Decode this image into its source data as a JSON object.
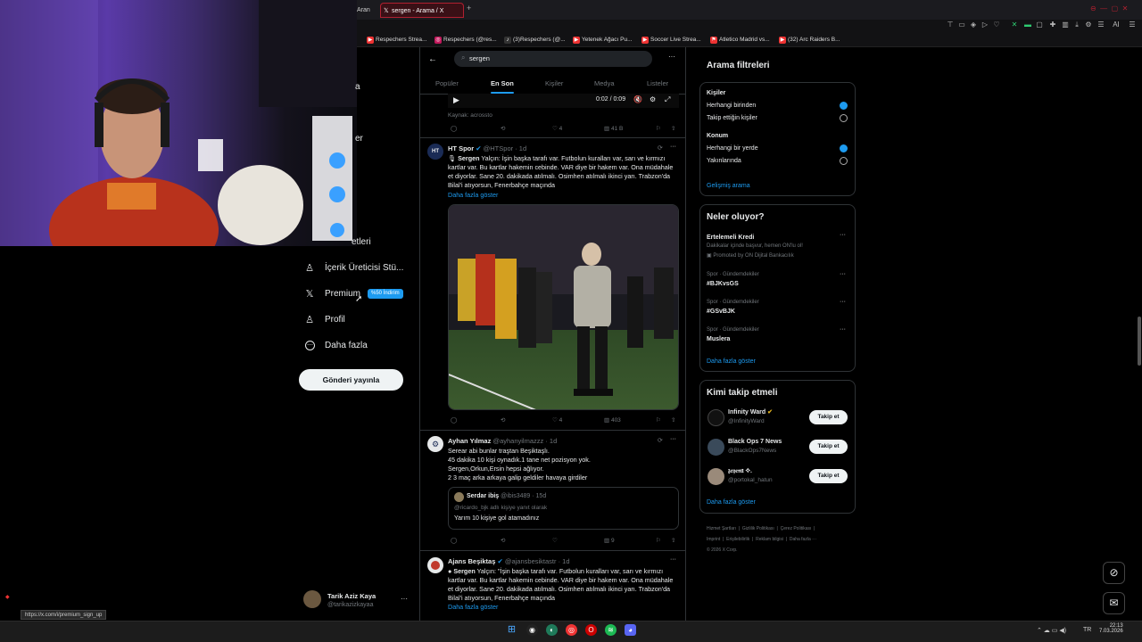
{
  "browser": {
    "tabs": [
      {
        "label": "Aran",
        "active": false
      },
      {
        "label": "sergen - Arama / X",
        "active": true
      }
    ],
    "new_tab": "+",
    "bookmarks": [
      {
        "label": "Respechers Strea...",
        "color": "#e33"
      },
      {
        "label": "Respechers (@res...",
        "color": "#c2185b"
      },
      {
        "label": "(3)Respechers (@...",
        "color": "#333"
      },
      {
        "label": "Yetenek Ağacı Pu...",
        "color": "#e33"
      },
      {
        "label": "Soccer Live Strea...",
        "color": "#e33"
      },
      {
        "label": "Atletico Madrid vs...",
        "color": "#e33"
      },
      {
        "label": "(32) Arc Raiders B...",
        "color": "#e33"
      }
    ],
    "toolbar_text": "AI",
    "status_url": "https://x.com/i/premium_sign_up"
  },
  "nav": {
    "partial_labels": [
      "a",
      "er",
      "etleri"
    ],
    "items": [
      {
        "label": "İçerik Üreticisi Stü...",
        "icon": "creator-studio-icon",
        "glyph": "♙"
      },
      {
        "label": "Premium",
        "icon": "x-logo-icon",
        "glyph": "𝕏",
        "badge": "%50 İndirim"
      },
      {
        "label": "Profil",
        "icon": "profile-icon",
        "glyph": "♙"
      },
      {
        "label": "Daha fazla",
        "icon": "more-circle-icon",
        "glyph": "⋯"
      }
    ],
    "post_button": "Gönderi yayınla",
    "account": {
      "name": "Tarik Aziz Kaya",
      "handle": "@tarikazizkayaa",
      "more": "···"
    }
  },
  "search": {
    "value": "sergen",
    "back": "←",
    "more": "···",
    "tabs": [
      {
        "label": "Popüler",
        "active": false
      },
      {
        "label": "En Son",
        "active": true
      },
      {
        "label": "Kişiler",
        "active": false
      },
      {
        "label": "Medya",
        "active": false
      },
      {
        "label": "Listeler",
        "active": false
      }
    ]
  },
  "video_bar": {
    "time": "0:02 / 0:09",
    "source": "Kaynak: acrossto",
    "likes": "4",
    "views": "41 B"
  },
  "tweets": [
    {
      "name": "HT Spor",
      "handle": "@HTSpor · 1d",
      "avatar": "HT",
      "lead": "Sergen",
      "text": " Yalçın: İşin başka tarafı var. Futbolun kuralları var, sarı ve kırmızı kartlar var. Bu kartlar hakemin cebinde. VAR diye bir hakem var. Ona müdahale et diyorlar. Sane 20. dakikada atılmalı. Osimhen atılmalı ikinci yarı. Trabzon'da Bilal'i atıyorsun, Fenerbahçe maçında",
      "show_more": "Daha fazla göster",
      "likes": "4",
      "views": "403"
    },
    {
      "name": "Ayhan Yılmaz",
      "handle": "@ayhanyilmazzz · 1d",
      "lines": [
        "Serear abi bunlar traştan Beşiktaşlı.",
        "45 dakika 10 kişi oynadık.1 tane net pozisyon yok.",
        "Sergen,Orkun,Ersin hepsi ağlıyor.",
        "2 3 maç arka arkaya galip geldiler havaya girdiler"
      ],
      "quote": {
        "name": "Serdar ibiş",
        "handle": "@ibis3489 · 15d",
        "reply": "@ricardo_bjk adlı kişiye yanıt olarak",
        "text": "Yarım 10 kişiye gol atamadınız"
      },
      "views": "9"
    },
    {
      "name": "Ajans Beşiktaş",
      "handle": "@ajansbesiktastr · 1d",
      "lead": "Sergen",
      "text": " Yalçın: \"İşin başka tarafı var. Futbolun kuralları var, sarı ve kırmızı kartlar var. Bu kartlar hakemin cebinde. VAR diye bir hakem var. Ona müdahale et diyorlar. Sane 20. dakikada atılmalı. Osimhen atılmalı ikinci yarı. Trabzon'da Bilal'i atıyorsun, Fenerbahçe maçında",
      "show_more": "Daha fazla göster"
    }
  ],
  "filters": {
    "title": "Arama filtreleri",
    "people_title": "Kişiler",
    "people": [
      {
        "label": "Herhangi birinden",
        "on": true
      },
      {
        "label": "Takip ettiğin kişiler",
        "on": false
      }
    ],
    "location_title": "Konum",
    "location": [
      {
        "label": "Herhangi bir yerde",
        "on": true
      },
      {
        "label": "Yakınlarında",
        "on": false
      }
    ],
    "advanced": "Gelişmiş arama"
  },
  "trends": {
    "title": "Neler oluyor?",
    "ad": {
      "title": "Ertelemeli Kredi",
      "desc": "Dakikalar içinde başvur, hemen ON'lu ol!",
      "promo": "Promoted by ON Dijital Bankacılık"
    },
    "items": [
      {
        "cat": "Spor · Gündemdekiler",
        "tag": "#BJKvsGS"
      },
      {
        "cat": "Spor · Gündemdekiler",
        "tag": "#GSvBJK"
      },
      {
        "cat": "Spor · Gündemdekiler",
        "tag": "Muslera"
      }
    ],
    "more": "Daha fazla göster"
  },
  "who_to_follow": {
    "title": "Kimi takip etmeli",
    "users": [
      {
        "name": "Infinity Ward",
        "handle": "@InfinityWard",
        "button": "Takip et"
      },
      {
        "name": "Black Ops 7 News",
        "handle": "@BlackOps7News",
        "button": "Takip et"
      },
      {
        "name": "𝔷𝔢𝔶𝔢𝔫𝔞 ✧.",
        "handle": "@portokal_hatun",
        "button": "Takip et"
      }
    ],
    "more": "Daha fazla göster"
  },
  "footer": {
    "links": [
      "Hizmet Şartları",
      "Gizlilik Politikası",
      "Çerez Politikası",
      "Imprint",
      "Erişilebilirlik",
      "Reklam bilgisi",
      "Daha fazla ···"
    ],
    "copyright": "© 2026 X Corp."
  },
  "taskbar": {
    "time": "22:13",
    "date": "7.03.2026",
    "lang": "TR"
  },
  "colors": {
    "accent": "#1d9bf0",
    "tab_active": "#b02030"
  }
}
